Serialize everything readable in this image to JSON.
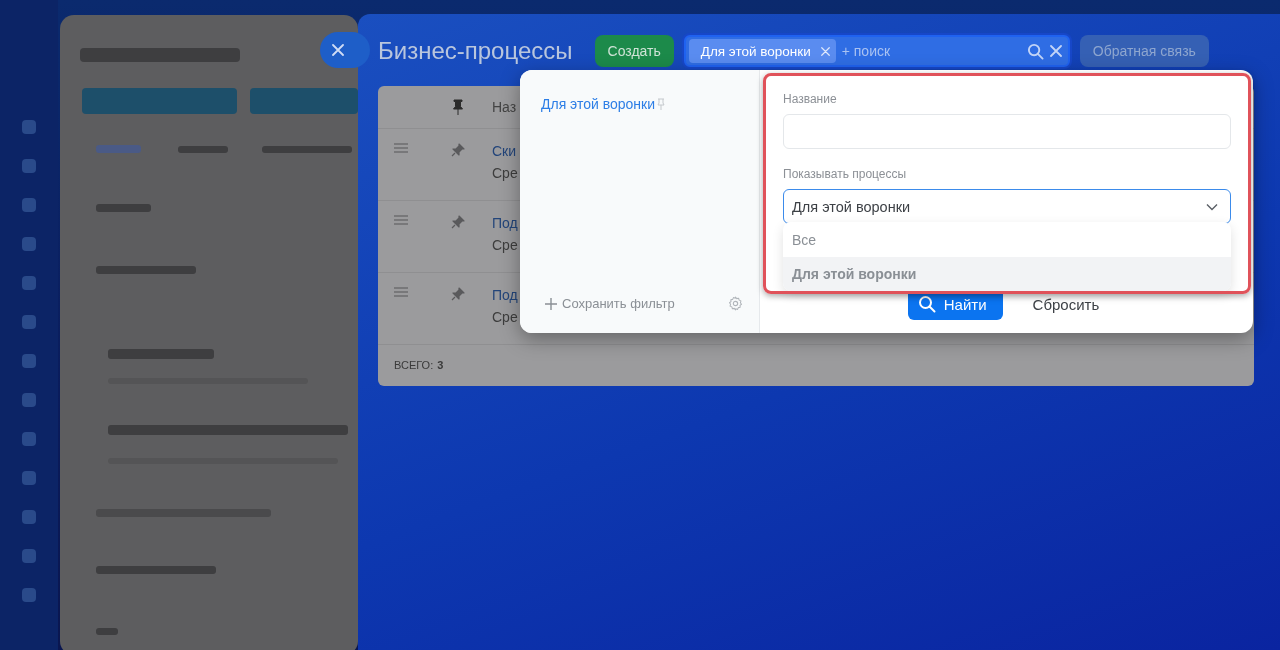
{
  "title": "Бизнес-процессы",
  "create_button": "Создать",
  "search": {
    "tags": [
      "Для этой воронки"
    ],
    "placeholder": "+ поиск"
  },
  "feedback_button": "Обратная связь",
  "table": {
    "header": "Наз",
    "rows": [
      {
        "title": "Ски",
        "subtitle": "Сре"
      },
      {
        "title": "Под",
        "subtitle": "Сре"
      },
      {
        "title": "Под",
        "subtitle": "Сре"
      }
    ],
    "footer": {
      "label": "ВСЕГО:",
      "value": "3"
    }
  },
  "filter_popup": {
    "presets": [
      "Для этой воронки"
    ],
    "save_filter": "Сохранить фильтр",
    "fields": [
      {
        "kind": "text",
        "label": "Название"
      },
      {
        "kind": "select",
        "label": "Показывать процессы",
        "value": "Для этой воронки",
        "expanded": true,
        "options": [
          {
            "label": "Все",
            "selected": false
          },
          {
            "label": "Для этой воронки",
            "selected": true
          }
        ]
      }
    ],
    "find_button": "Найти",
    "reset_button": "Сбросить"
  }
}
